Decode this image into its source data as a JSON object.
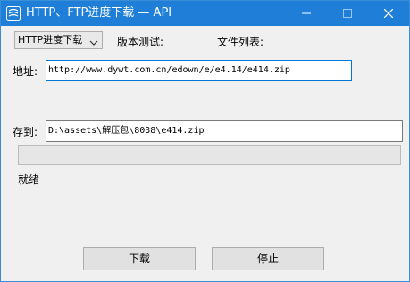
{
  "window": {
    "title": "HTTP、FTP进度下载 — API",
    "minimize_glyph": "—",
    "maximize_glyph": "☐",
    "close_glyph": "✕",
    "title_bar_color": "#1f7fd8"
  },
  "toolbar": {
    "mode_select_value": "HTTP进度下载",
    "version_test_label": "版本测试:",
    "file_list_label": "文件列表:"
  },
  "form": {
    "address_label": "地址:",
    "address_value": "http://www.dywt.com.cn/edown/e/e4.14/e414.zip",
    "save_to_label": "存到:",
    "save_to_value": "D:\\assets\\解压包\\8038\\e414.zip"
  },
  "progress": {
    "value": 0
  },
  "status": {
    "text": "就绪"
  },
  "buttons": {
    "download_label": "下载",
    "stop_label": "停止"
  },
  "icons": {
    "app": "app-logo-icon",
    "dropdown": "chevron-down-icon"
  }
}
